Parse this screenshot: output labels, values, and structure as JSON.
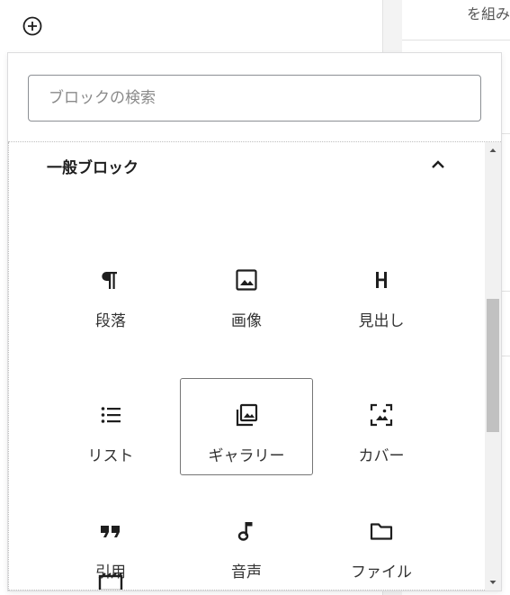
{
  "background": {
    "right_panel_text": "を組み"
  },
  "inserter": {
    "search_placeholder": "ブロックの検索",
    "category_title": "一般ブロック",
    "blocks": [
      {
        "label": "段落",
        "icon": "paragraph-icon"
      },
      {
        "label": "画像",
        "icon": "image-icon"
      },
      {
        "label": "見出し",
        "icon": "heading-icon"
      },
      {
        "label": "リスト",
        "icon": "list-icon"
      },
      {
        "label": "ギャラリー",
        "icon": "gallery-icon",
        "selected": true
      },
      {
        "label": "カバー",
        "icon": "cover-icon"
      },
      {
        "label": "引用",
        "icon": "quote-icon"
      },
      {
        "label": "音声",
        "icon": "audio-icon"
      },
      {
        "label": "ファイル",
        "icon": "file-folder-icon"
      }
    ]
  },
  "colors": {
    "icon": "#1e1e1e",
    "selected_border": "#757575",
    "scroll_thumb": "#c1c1c1"
  }
}
